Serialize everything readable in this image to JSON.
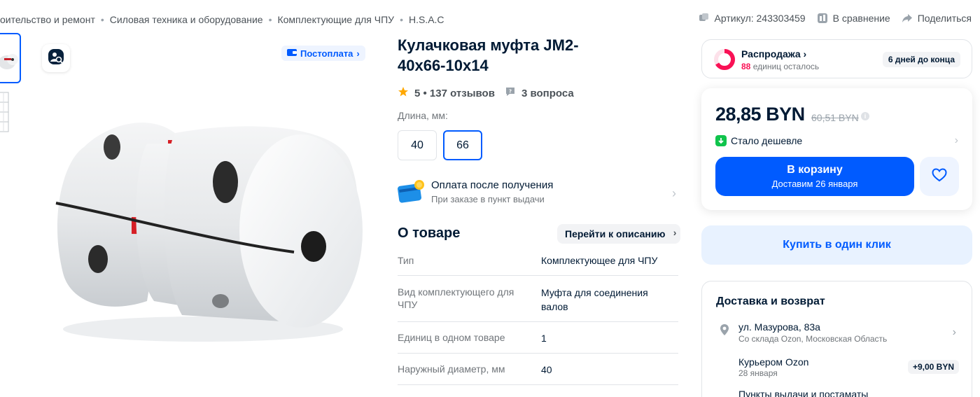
{
  "breadcrumbs": [
    "оительство и ремонт",
    "Силовая техника и оборудование",
    "Комплектующие для ЧПУ",
    "H.S.A.C"
  ],
  "header_meta": {
    "article": "Артикул: 243303459",
    "compare": "В сравнение",
    "share": "Поделиться"
  },
  "gallery": {
    "postpay_badge": "Постоплата"
  },
  "product": {
    "title": "Кулачковая муфта JM2-40x66-10x14",
    "rating": "5 • 137 отзывов",
    "questions": "3 вопроса",
    "length_label": "Длина, мм:",
    "length_options": [
      "40",
      "66"
    ],
    "selected_length": "66"
  },
  "payment": {
    "title": "Оплата после получения",
    "subtitle": "При заказе в пункт выдачи"
  },
  "about": {
    "title": "О товаре",
    "goto_label": "Перейти к описанию",
    "specs": [
      {
        "key": "Тип",
        "value": "Комплектующее для ЧПУ"
      },
      {
        "key": "Вид комплектующего для ЧПУ",
        "value": "Муфта для соединения валов"
      },
      {
        "key": "Единиц в одном товаре",
        "value": "1"
      },
      {
        "key": "Наружный диаметр, мм",
        "value": "40"
      }
    ]
  },
  "sale": {
    "title": "Распродажа",
    "units_count": "88",
    "units_text": "единиц осталось",
    "days_left": "6 дней до конца"
  },
  "price": {
    "current": "28,85 BYN",
    "old": "60,51 BYN",
    "cheaper_label": "Стало дешевле",
    "cart_label": "В корзину",
    "cart_sub": "Доставим 26 января"
  },
  "one_click": "Купить в один клик",
  "delivery": {
    "title": "Доставка и возврат",
    "address": "ул. Мазурова, 83а",
    "address_sub": "Со склада Ozon, Московская Область",
    "courier": "Курьером Ozon",
    "courier_date": "28 января",
    "courier_price": "+9,00 BYN",
    "points": "Пункты выдачи и постаматы"
  },
  "colors": {
    "accent": "#005bff",
    "sale_pink": "#f91155",
    "green": "#10c44c",
    "star": "#ffa800"
  }
}
